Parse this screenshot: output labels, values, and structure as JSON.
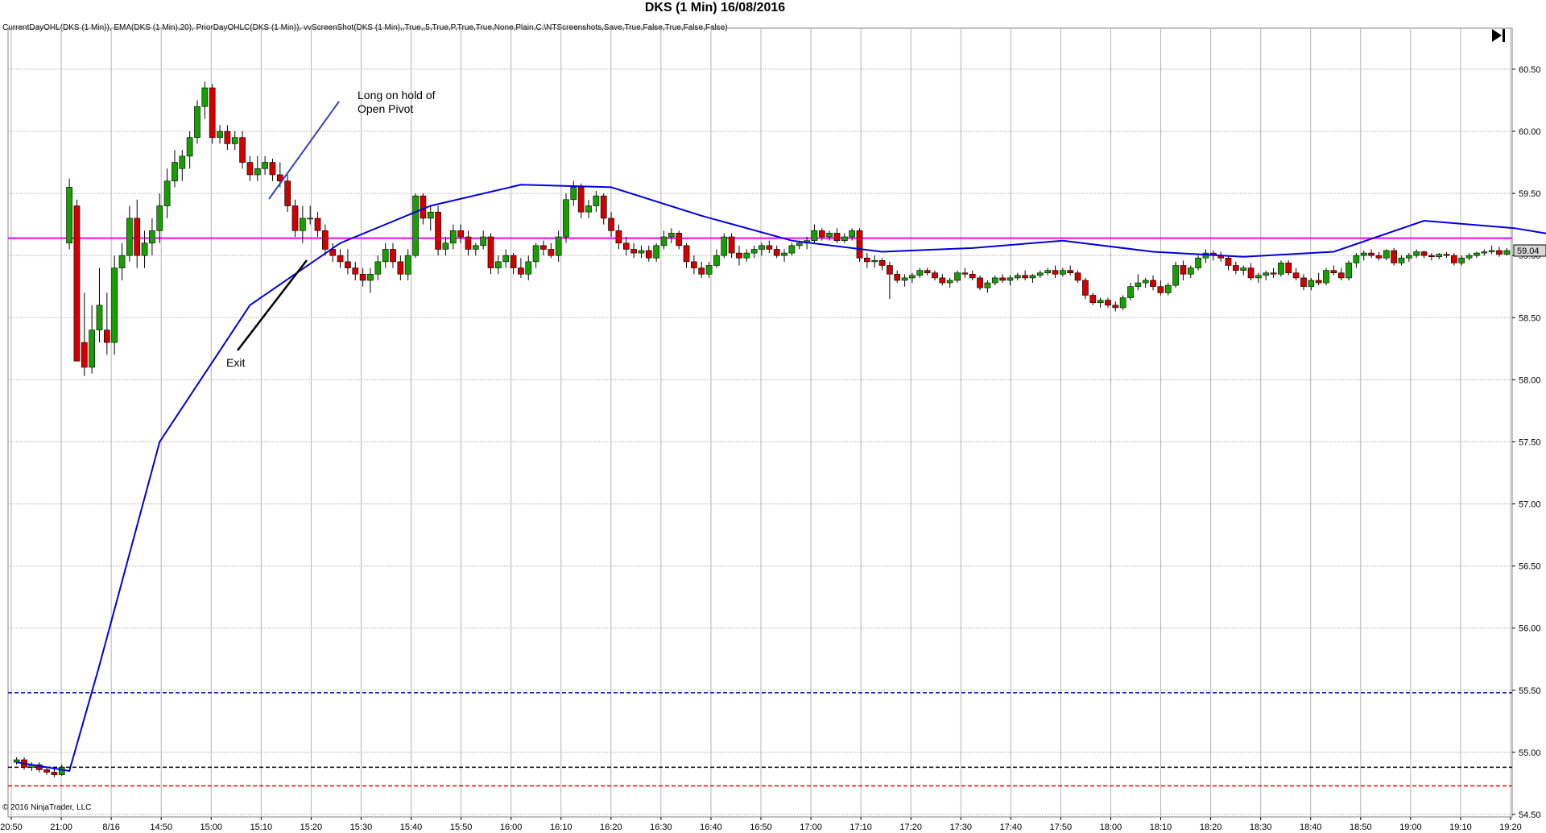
{
  "header": {
    "title": "DKS (1 Min)  16/08/2016",
    "indicators": "CurrentDayOHL(DKS (1 Min)), EMA(DKS (1 Min),20), PriorDayOHLC(DKS (1 Min)), vvScreenShot(DKS (1 Min),,True,,5,True,P,True,True,None,Plain,C:\\NTScreenshots,Save,True,False,True,False,False)",
    "copyright": "© 2016 NinjaTrader, LLC"
  },
  "icons": {
    "go_last": "skip-to-end-icon"
  },
  "chart_data": {
    "type": "candlestick",
    "ylim": [
      54.48,
      60.72
    ],
    "y_ticks": [
      "60.50",
      "60.00",
      "59.50",
      "59.00",
      "58.50",
      "58.00",
      "57.50",
      "57.00",
      "56.50",
      "56.00",
      "55.50",
      "55.00",
      "54.50"
    ],
    "x_ticks": [
      "20:50",
      "21:00",
      "8/16",
      "14:50",
      "15:00",
      "15:10",
      "15:20",
      "15:30",
      "15:40",
      "15:50",
      "16:00",
      "16:10",
      "16:20",
      "16:30",
      "16:40",
      "16:50",
      "17:00",
      "17:10",
      "17:20",
      "17:30",
      "17:40",
      "17:50",
      "18:00",
      "18:10",
      "18:20",
      "18:30",
      "18:40",
      "18:50",
      "19:00",
      "19:10",
      "19:20"
    ],
    "last_price": "59.04",
    "colors": {
      "up_candle": "#16a000",
      "down_candle": "#d00000",
      "ema": "#0000e0",
      "current_open": "#ff00ff",
      "prior_high": "#0000c0",
      "prior_close": "#000000",
      "prior_low": "#ff0000",
      "grid": "#b4b4b4"
    },
    "lines": [
      {
        "name": "current-day-open",
        "value": 59.14,
        "style": "solid",
        "color": "#ff00ff"
      },
      {
        "name": "prior-day-high",
        "value": 55.48,
        "style": "dashed",
        "color": "#0000c0"
      },
      {
        "name": "prior-day-close",
        "value": 54.88,
        "style": "dashed",
        "color": "#000000"
      },
      {
        "name": "prior-day-low",
        "value": 54.73,
        "style": "dashed",
        "color": "#ff0000"
      }
    ],
    "candles": [
      [
        54.92,
        54.96,
        54.9,
        54.94
      ],
      [
        54.94,
        54.96,
        54.86,
        54.88
      ],
      [
        54.88,
        54.92,
        54.85,
        54.9
      ],
      [
        54.9,
        54.92,
        54.84,
        54.86
      ],
      [
        54.86,
        54.88,
        54.82,
        54.84
      ],
      [
        54.84,
        54.87,
        54.8,
        54.82
      ],
      [
        54.82,
        54.9,
        54.81,
        54.88
      ],
      [
        59.1,
        59.62,
        59.05,
        59.55
      ],
      [
        59.4,
        59.45,
        58.2,
        58.15
      ],
      [
        58.3,
        58.7,
        58.03,
        58.1
      ],
      [
        58.1,
        58.6,
        58.05,
        58.4
      ],
      [
        58.4,
        58.9,
        58.3,
        58.6
      ],
      [
        58.4,
        58.7,
        58.2,
        58.3
      ],
      [
        58.3,
        59.0,
        58.2,
        58.9
      ],
      [
        58.9,
        59.1,
        58.8,
        59.0
      ],
      [
        59.0,
        59.4,
        58.95,
        59.3
      ],
      [
        59.3,
        59.45,
        58.9,
        59.0
      ],
      [
        59.0,
        59.2,
        58.9,
        59.1
      ],
      [
        59.1,
        59.3,
        59.0,
        59.2
      ],
      [
        59.2,
        59.5,
        59.1,
        59.4
      ],
      [
        59.4,
        59.7,
        59.3,
        59.6
      ],
      [
        59.6,
        59.85,
        59.55,
        59.75
      ],
      [
        59.7,
        59.85,
        59.6,
        59.8
      ],
      [
        59.8,
        60.0,
        59.7,
        59.95
      ],
      [
        59.95,
        60.25,
        59.9,
        60.2
      ],
      [
        60.2,
        60.4,
        60.1,
        60.35
      ],
      [
        60.35,
        60.38,
        59.9,
        59.95
      ],
      [
        59.95,
        60.05,
        59.9,
        60.0
      ],
      [
        60.0,
        60.05,
        59.85,
        59.9
      ],
      [
        59.9,
        60.0,
        59.85,
        59.95
      ],
      [
        59.95,
        60.0,
        59.7,
        59.75
      ],
      [
        59.75,
        59.8,
        59.6,
        59.65
      ],
      [
        59.65,
        59.8,
        59.6,
        59.7
      ],
      [
        59.7,
        59.8,
        59.65,
        59.75
      ],
      [
        59.75,
        59.78,
        59.6,
        59.65
      ],
      [
        59.65,
        59.75,
        59.55,
        59.6
      ],
      [
        59.6,
        59.65,
        59.35,
        59.4
      ],
      [
        59.4,
        59.45,
        59.15,
        59.2
      ],
      [
        59.2,
        59.4,
        59.1,
        59.3
      ],
      [
        59.3,
        59.4,
        59.25,
        59.3
      ],
      [
        59.3,
        59.35,
        59.15,
        59.2
      ],
      [
        59.2,
        59.25,
        59.0,
        59.05
      ],
      [
        59.05,
        59.1,
        58.95,
        59.0
      ],
      [
        59.0,
        59.05,
        58.9,
        58.95
      ],
      [
        58.95,
        59.05,
        58.85,
        58.9
      ],
      [
        58.9,
        58.95,
        58.8,
        58.85
      ],
      [
        58.85,
        58.9,
        58.75,
        58.8
      ],
      [
        58.8,
        58.9,
        58.7,
        58.85
      ],
      [
        58.85,
        59.0,
        58.8,
        58.95
      ],
      [
        58.95,
        59.1,
        58.9,
        59.05
      ],
      [
        59.05,
        59.1,
        58.9,
        58.95
      ],
      [
        58.95,
        59.0,
        58.8,
        58.85
      ],
      [
        58.85,
        59.05,
        58.8,
        59.0
      ],
      [
        59.0,
        59.5,
        58.98,
        59.48
      ],
      [
        59.48,
        59.5,
        59.25,
        59.3
      ],
      [
        59.3,
        59.4,
        59.2,
        59.35
      ],
      [
        59.35,
        59.4,
        59.0,
        59.05
      ],
      [
        59.05,
        59.15,
        59.0,
        59.1
      ],
      [
        59.1,
        59.25,
        59.05,
        59.2
      ],
      [
        59.2,
        59.25,
        59.1,
        59.15
      ],
      [
        59.15,
        59.2,
        59.0,
        59.05
      ],
      [
        59.05,
        59.1,
        59.0,
        59.08
      ],
      [
        59.08,
        59.2,
        59.05,
        59.15
      ],
      [
        59.15,
        59.18,
        58.85,
        58.9
      ],
      [
        58.9,
        59.0,
        58.85,
        58.95
      ],
      [
        58.95,
        59.05,
        58.9,
        59.0
      ],
      [
        59.0,
        59.02,
        58.85,
        58.9
      ],
      [
        58.9,
        58.98,
        58.82,
        58.85
      ],
      [
        58.85,
        59.0,
        58.8,
        58.95
      ],
      [
        58.95,
        59.1,
        58.9,
        59.08
      ],
      [
        59.08,
        59.12,
        59.0,
        59.05
      ],
      [
        59.05,
        59.1,
        58.98,
        59.0
      ],
      [
        59.0,
        59.2,
        58.95,
        59.15
      ],
      [
        59.15,
        59.5,
        59.1,
        59.45
      ],
      [
        59.45,
        59.6,
        59.4,
        59.55
      ],
      [
        59.55,
        59.58,
        59.3,
        59.35
      ],
      [
        59.35,
        59.45,
        59.3,
        59.4
      ],
      [
        59.4,
        59.52,
        59.35,
        59.48
      ],
      [
        59.48,
        59.5,
        59.25,
        59.3
      ],
      [
        59.3,
        59.35,
        59.15,
        59.2
      ],
      [
        59.2,
        59.25,
        59.05,
        59.1
      ],
      [
        59.1,
        59.15,
        59.0,
        59.05
      ],
      [
        59.05,
        59.1,
        58.98,
        59.02
      ],
      [
        59.02,
        59.08,
        58.98,
        59.04
      ],
      [
        59.04,
        59.08,
        58.95,
        58.98
      ],
      [
        58.98,
        59.1,
        58.95,
        59.08
      ],
      [
        59.08,
        59.2,
        59.05,
        59.15
      ],
      [
        59.15,
        59.22,
        59.1,
        59.18
      ],
      [
        59.18,
        59.2,
        59.05,
        59.08
      ],
      [
        59.08,
        59.1,
        58.9,
        58.95
      ],
      [
        58.95,
        59.0,
        58.85,
        58.9
      ],
      [
        58.9,
        58.95,
        58.82,
        58.85
      ],
      [
        58.85,
        58.95,
        58.82,
        58.92
      ],
      [
        58.92,
        59.05,
        58.9,
        59.0
      ],
      [
        59.0,
        59.18,
        58.98,
        59.15
      ],
      [
        59.15,
        59.18,
        58.98,
        59.02
      ],
      [
        59.02,
        59.08,
        58.92,
        58.98
      ],
      [
        58.98,
        59.05,
        58.95,
        59.02
      ],
      [
        59.02,
        59.08,
        58.98,
        59.05
      ],
      [
        59.05,
        59.1,
        59.0,
        59.08
      ],
      [
        59.08,
        59.12,
        59.02,
        59.05
      ],
      [
        59.05,
        59.08,
        58.98,
        59.0
      ],
      [
        59.0,
        59.05,
        58.95,
        59.02
      ],
      [
        59.02,
        59.1,
        59.0,
        59.08
      ],
      [
        59.08,
        59.12,
        59.05,
        59.1
      ],
      [
        59.1,
        59.15,
        59.05,
        59.12
      ],
      [
        59.12,
        59.25,
        59.1,
        59.2
      ],
      [
        59.2,
        59.22,
        59.12,
        59.15
      ],
      [
        59.15,
        59.2,
        59.12,
        59.18
      ],
      [
        59.18,
        59.22,
        59.1,
        59.12
      ],
      [
        59.12,
        59.18,
        59.1,
        59.15
      ],
      [
        59.15,
        59.22,
        59.12,
        59.2
      ],
      [
        59.2,
        59.22,
        58.95,
        58.98
      ],
      [
        58.98,
        59.02,
        58.9,
        58.95
      ],
      [
        58.95,
        59.0,
        58.9,
        58.96
      ],
      [
        58.96,
        58.98,
        58.88,
        58.92
      ],
      [
        58.92,
        58.95,
        58.65,
        58.85
      ],
      [
        58.85,
        58.88,
        58.78,
        58.8
      ],
      [
        58.8,
        58.85,
        58.75,
        58.82
      ],
      [
        58.82,
        58.86,
        58.78,
        58.84
      ],
      [
        58.84,
        58.9,
        58.82,
        58.88
      ],
      [
        58.88,
        58.9,
        58.84,
        58.86
      ],
      [
        58.86,
        58.88,
        58.8,
        58.82
      ],
      [
        58.82,
        58.85,
        58.76,
        58.78
      ],
      [
        58.78,
        58.82,
        58.74,
        58.8
      ],
      [
        58.8,
        58.88,
        58.78,
        58.86
      ],
      [
        58.86,
        58.9,
        58.82,
        58.85
      ],
      [
        58.85,
        58.88,
        58.8,
        58.82
      ],
      [
        58.82,
        58.84,
        58.72,
        58.74
      ],
      [
        58.74,
        58.8,
        58.7,
        58.78
      ],
      [
        58.78,
        58.84,
        58.76,
        58.82
      ],
      [
        58.82,
        58.85,
        58.78,
        58.8
      ],
      [
        58.8,
        58.84,
        58.76,
        58.82
      ],
      [
        58.82,
        58.86,
        58.8,
        58.84
      ],
      [
        58.84,
        58.88,
        58.8,
        58.82
      ],
      [
        58.82,
        58.85,
        58.78,
        58.84
      ],
      [
        58.84,
        58.88,
        58.82,
        58.86
      ],
      [
        58.86,
        58.9,
        58.84,
        58.88
      ],
      [
        58.88,
        58.92,
        58.82,
        58.85
      ],
      [
        58.85,
        58.9,
        58.83,
        58.88
      ],
      [
        58.88,
        58.92,
        58.84,
        58.86
      ],
      [
        58.86,
        58.88,
        58.78,
        58.8
      ],
      [
        58.8,
        58.82,
        58.65,
        58.68
      ],
      [
        58.68,
        58.7,
        58.6,
        58.62
      ],
      [
        58.62,
        58.66,
        58.58,
        58.64
      ],
      [
        58.64,
        58.66,
        58.58,
        58.6
      ],
      [
        58.6,
        58.63,
        58.55,
        58.58
      ],
      [
        58.58,
        58.68,
        58.56,
        58.66
      ],
      [
        58.66,
        58.78,
        58.64,
        58.75
      ],
      [
        58.75,
        58.85,
        58.72,
        58.78
      ],
      [
        58.78,
        58.82,
        58.74,
        58.8
      ],
      [
        58.8,
        58.84,
        58.72,
        58.75
      ],
      [
        58.75,
        58.8,
        58.68,
        58.7
      ],
      [
        58.7,
        58.78,
        58.68,
        58.76
      ],
      [
        58.76,
        58.95,
        58.74,
        58.92
      ],
      [
        58.92,
        58.96,
        58.8,
        58.85
      ],
      [
        58.85,
        58.92,
        58.82,
        58.9
      ],
      [
        58.9,
        59.0,
        58.88,
        58.98
      ],
      [
        58.98,
        59.05,
        58.94,
        59.02
      ],
      [
        59.02,
        59.04,
        58.96,
        59.0
      ],
      [
        59.0,
        59.03,
        58.95,
        58.98
      ],
      [
        58.98,
        59.0,
        58.88,
        58.92
      ],
      [
        58.92,
        58.95,
        58.85,
        58.88
      ],
      [
        58.88,
        58.92,
        58.84,
        58.9
      ],
      [
        58.9,
        58.94,
        58.8,
        58.82
      ],
      [
        58.82,
        58.86,
        58.78,
        58.84
      ],
      [
        58.84,
        58.88,
        58.8,
        58.86
      ],
      [
        58.86,
        58.9,
        58.82,
        58.85
      ],
      [
        58.85,
        58.96,
        58.83,
        58.94
      ],
      [
        58.94,
        58.96,
        58.84,
        58.86
      ],
      [
        58.86,
        58.9,
        58.8,
        58.82
      ],
      [
        58.82,
        58.85,
        58.72,
        58.75
      ],
      [
        58.75,
        58.82,
        58.72,
        58.8
      ],
      [
        58.8,
        58.86,
        58.76,
        58.78
      ],
      [
        58.78,
        58.9,
        58.76,
        58.88
      ],
      [
        58.88,
        58.92,
        58.84,
        58.86
      ],
      [
        58.86,
        58.9,
        58.8,
        58.82
      ],
      [
        58.82,
        58.96,
        58.8,
        58.94
      ],
      [
        58.94,
        59.02,
        58.9,
        59.0
      ],
      [
        59.0,
        59.04,
        58.96,
        59.02
      ],
      [
        59.02,
        59.05,
        58.98,
        59.0
      ],
      [
        59.0,
        59.03,
        58.96,
        58.98
      ],
      [
        58.98,
        59.05,
        58.96,
        59.04
      ],
      [
        59.04,
        59.06,
        58.92,
        58.94
      ],
      [
        58.94,
        59.0,
        58.92,
        58.98
      ],
      [
        58.98,
        59.02,
        58.95,
        59.0
      ],
      [
        59.0,
        59.05,
        58.98,
        59.03
      ],
      [
        59.03,
        59.04,
        58.98,
        59.0
      ],
      [
        59.0,
        59.02,
        58.96,
        58.99
      ],
      [
        58.99,
        59.02,
        58.97,
        59.01
      ],
      [
        59.01,
        59.03,
        58.98,
        59.0
      ],
      [
        59.0,
        59.02,
        58.92,
        58.94
      ],
      [
        58.94,
        59.0,
        58.92,
        58.98
      ],
      [
        58.98,
        59.02,
        58.96,
        59.0
      ],
      [
        59.0,
        59.03,
        58.98,
        59.02
      ],
      [
        59.02,
        59.05,
        59.0,
        59.03
      ],
      [
        59.03,
        59.08,
        59.01,
        59.04
      ],
      [
        59.04,
        59.07,
        58.99,
        59.01
      ],
      [
        59.01,
        59.06,
        59.0,
        59.04
      ]
    ],
    "ema": [
      [
        0,
        54.92
      ],
      [
        7,
        54.85
      ],
      [
        11,
        55.7
      ],
      [
        19,
        57.5
      ],
      [
        31,
        58.6
      ],
      [
        43,
        59.1
      ],
      [
        55,
        59.4
      ],
      [
        67,
        59.57
      ],
      [
        79,
        59.55
      ],
      [
        91,
        59.32
      ],
      [
        103,
        59.12
      ],
      [
        115,
        59.03
      ],
      [
        127,
        59.06
      ],
      [
        139,
        59.12
      ],
      [
        151,
        59.03
      ],
      [
        163,
        58.99
      ],
      [
        175,
        59.03
      ],
      [
        187,
        59.28
      ],
      [
        199,
        59.22
      ],
      [
        211,
        59.1
      ],
      [
        223,
        59.08
      ],
      [
        235,
        59.06
      ],
      [
        247,
        59.06
      ],
      [
        259,
        59.1
      ],
      [
        271,
        59.11
      ],
      [
        283,
        59.14
      ],
      [
        295,
        59.04
      ],
      [
        307,
        58.96
      ],
      [
        319,
        58.89
      ],
      [
        331,
        58.85
      ],
      [
        343,
        58.84
      ],
      [
        355,
        58.87
      ],
      [
        367,
        58.78
      ],
      [
        379,
        58.72
      ],
      [
        391,
        58.8
      ],
      [
        403,
        58.9
      ],
      [
        415,
        58.9
      ],
      [
        427,
        58.86
      ],
      [
        439,
        58.86
      ],
      [
        451,
        58.85
      ],
      [
        463,
        58.92
      ],
      [
        475,
        58.97
      ],
      [
        487,
        58.99
      ],
      [
        499,
        58.99
      ],
      [
        511,
        59.02
      ],
      [
        521,
        59.04
      ]
    ],
    "annotations": [
      {
        "text_lines": [
          "Long on hold of",
          "Open Pivot"
        ],
        "color": "#3344cc"
      },
      {
        "text_lines": [
          "Exit"
        ],
        "color": "#000000"
      }
    ]
  }
}
